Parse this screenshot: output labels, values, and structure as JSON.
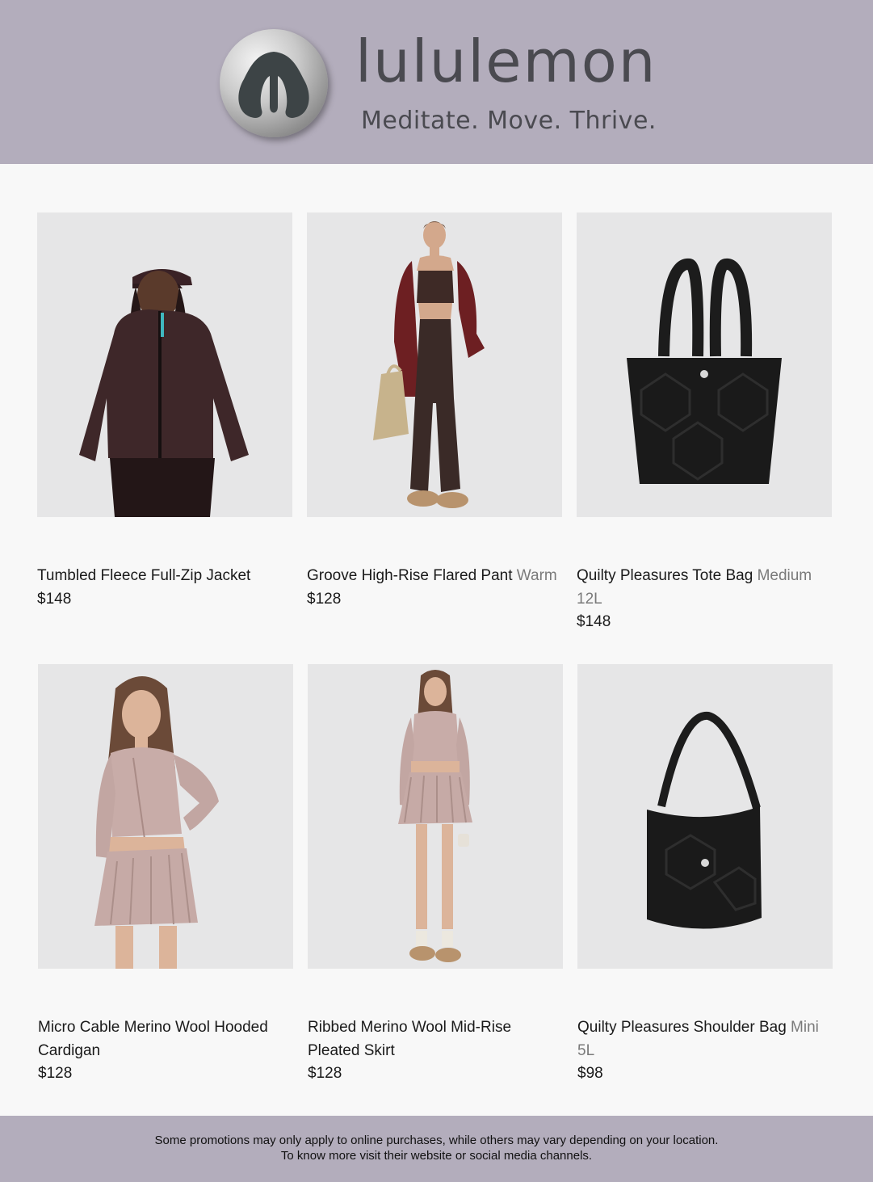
{
  "header": {
    "brand_name": "lululemon",
    "tagline": "Meditate. Move. Thrive.",
    "logo_icon": "lululemon-omega-logo-icon",
    "background_color": "#b3adbc"
  },
  "products": [
    {
      "name": "Tumbled Fleece Full-Zip Jacket",
      "variant": "",
      "price": "$148",
      "image": "model-in-dark-fleece-jacket-and-cap"
    },
    {
      "name": "Groove High-Rise Flared Pant",
      "variant": "Warm",
      "price": "$128",
      "image": "model-in-bra-flared-pants-red-jacket-tote"
    },
    {
      "name": "Quilty Pleasures Tote Bag",
      "variant": "Medium 12L",
      "price": "$148",
      "image": "black-quilted-tote-bag"
    },
    {
      "name": "Micro Cable Merino Wool Hooded Cardigan",
      "variant": "",
      "price": "$128",
      "image": "model-in-pink-cardigan-and-pleated-skirt"
    },
    {
      "name": "Ribbed Merino Wool Mid-Rise Pleated Skirt",
      "variant": "",
      "price": "$128",
      "image": "model-in-pink-knit-set-full-length"
    },
    {
      "name": "Quilty Pleasures Shoulder Bag",
      "variant": "Mini 5L",
      "price": "$98",
      "image": "black-quilted-shoulder-bag"
    }
  ],
  "footer": {
    "line1": "Some promotions may only apply to online purchases, while others may vary depending on your location.",
    "line2": "To know more visit their website or social media channels."
  }
}
